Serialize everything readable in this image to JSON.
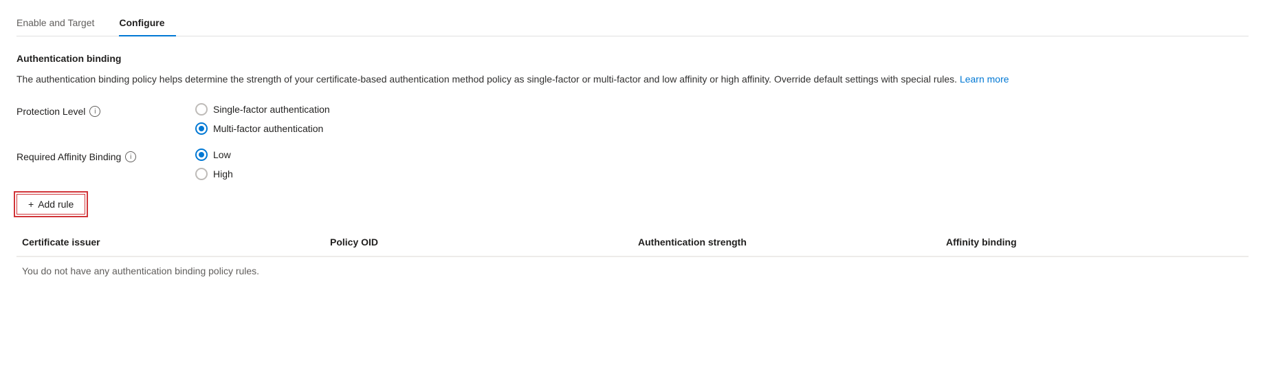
{
  "tabs": [
    {
      "id": "enable-target",
      "label": "Enable and Target",
      "active": false
    },
    {
      "id": "configure",
      "label": "Configure",
      "active": true
    }
  ],
  "section": {
    "title": "Authentication binding",
    "description": "The authentication binding policy helps determine the strength of your certificate-based authentication method policy as single-factor or multi-factor and low affinity or high affinity. Override default settings with special rules.",
    "learn_more_label": "Learn more"
  },
  "protection_level": {
    "label": "Protection Level",
    "options": [
      {
        "id": "single-factor",
        "label": "Single-factor authentication",
        "selected": false
      },
      {
        "id": "multi-factor",
        "label": "Multi-factor authentication",
        "selected": true
      }
    ]
  },
  "affinity_binding": {
    "label": "Required Affinity Binding",
    "options": [
      {
        "id": "low",
        "label": "Low",
        "selected": true
      },
      {
        "id": "high",
        "label": "High",
        "selected": false
      }
    ]
  },
  "add_rule_button": {
    "label": "Add rule",
    "plus": "+"
  },
  "table": {
    "headers": [
      "Certificate issuer",
      "Policy OID",
      "Authentication strength",
      "Affinity binding"
    ],
    "empty_message": "You do not have any authentication binding policy rules."
  }
}
